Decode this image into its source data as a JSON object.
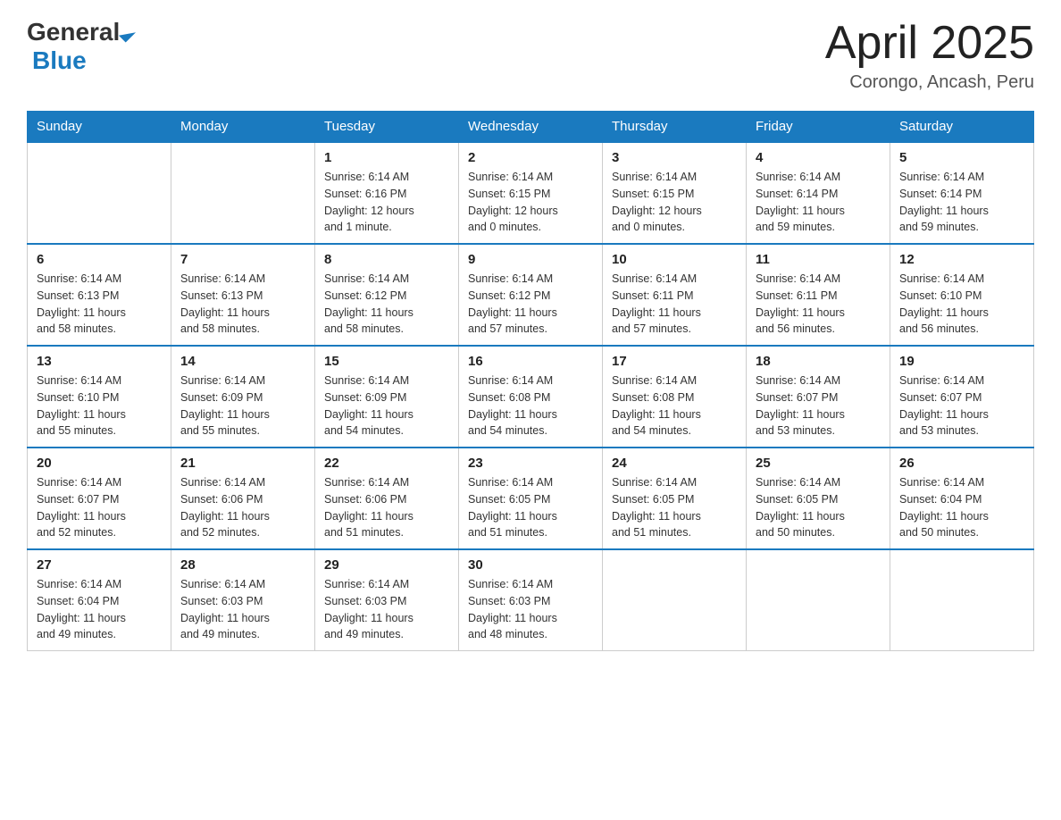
{
  "header": {
    "logo": {
      "general": "General",
      "triangle": "▶",
      "blue": "Blue"
    },
    "title": "April 2025",
    "location": "Corongo, Ancash, Peru"
  },
  "weekdays": [
    "Sunday",
    "Monday",
    "Tuesday",
    "Wednesday",
    "Thursday",
    "Friday",
    "Saturday"
  ],
  "weeks": [
    [
      {
        "day": "",
        "info": ""
      },
      {
        "day": "",
        "info": ""
      },
      {
        "day": "1",
        "info": "Sunrise: 6:14 AM\nSunset: 6:16 PM\nDaylight: 12 hours\nand 1 minute."
      },
      {
        "day": "2",
        "info": "Sunrise: 6:14 AM\nSunset: 6:15 PM\nDaylight: 12 hours\nand 0 minutes."
      },
      {
        "day": "3",
        "info": "Sunrise: 6:14 AM\nSunset: 6:15 PM\nDaylight: 12 hours\nand 0 minutes."
      },
      {
        "day": "4",
        "info": "Sunrise: 6:14 AM\nSunset: 6:14 PM\nDaylight: 11 hours\nand 59 minutes."
      },
      {
        "day": "5",
        "info": "Sunrise: 6:14 AM\nSunset: 6:14 PM\nDaylight: 11 hours\nand 59 minutes."
      }
    ],
    [
      {
        "day": "6",
        "info": "Sunrise: 6:14 AM\nSunset: 6:13 PM\nDaylight: 11 hours\nand 58 minutes."
      },
      {
        "day": "7",
        "info": "Sunrise: 6:14 AM\nSunset: 6:13 PM\nDaylight: 11 hours\nand 58 minutes."
      },
      {
        "day": "8",
        "info": "Sunrise: 6:14 AM\nSunset: 6:12 PM\nDaylight: 11 hours\nand 58 minutes."
      },
      {
        "day": "9",
        "info": "Sunrise: 6:14 AM\nSunset: 6:12 PM\nDaylight: 11 hours\nand 57 minutes."
      },
      {
        "day": "10",
        "info": "Sunrise: 6:14 AM\nSunset: 6:11 PM\nDaylight: 11 hours\nand 57 minutes."
      },
      {
        "day": "11",
        "info": "Sunrise: 6:14 AM\nSunset: 6:11 PM\nDaylight: 11 hours\nand 56 minutes."
      },
      {
        "day": "12",
        "info": "Sunrise: 6:14 AM\nSunset: 6:10 PM\nDaylight: 11 hours\nand 56 minutes."
      }
    ],
    [
      {
        "day": "13",
        "info": "Sunrise: 6:14 AM\nSunset: 6:10 PM\nDaylight: 11 hours\nand 55 minutes."
      },
      {
        "day": "14",
        "info": "Sunrise: 6:14 AM\nSunset: 6:09 PM\nDaylight: 11 hours\nand 55 minutes."
      },
      {
        "day": "15",
        "info": "Sunrise: 6:14 AM\nSunset: 6:09 PM\nDaylight: 11 hours\nand 54 minutes."
      },
      {
        "day": "16",
        "info": "Sunrise: 6:14 AM\nSunset: 6:08 PM\nDaylight: 11 hours\nand 54 minutes."
      },
      {
        "day": "17",
        "info": "Sunrise: 6:14 AM\nSunset: 6:08 PM\nDaylight: 11 hours\nand 54 minutes."
      },
      {
        "day": "18",
        "info": "Sunrise: 6:14 AM\nSunset: 6:07 PM\nDaylight: 11 hours\nand 53 minutes."
      },
      {
        "day": "19",
        "info": "Sunrise: 6:14 AM\nSunset: 6:07 PM\nDaylight: 11 hours\nand 53 minutes."
      }
    ],
    [
      {
        "day": "20",
        "info": "Sunrise: 6:14 AM\nSunset: 6:07 PM\nDaylight: 11 hours\nand 52 minutes."
      },
      {
        "day": "21",
        "info": "Sunrise: 6:14 AM\nSunset: 6:06 PM\nDaylight: 11 hours\nand 52 minutes."
      },
      {
        "day": "22",
        "info": "Sunrise: 6:14 AM\nSunset: 6:06 PM\nDaylight: 11 hours\nand 51 minutes."
      },
      {
        "day": "23",
        "info": "Sunrise: 6:14 AM\nSunset: 6:05 PM\nDaylight: 11 hours\nand 51 minutes."
      },
      {
        "day": "24",
        "info": "Sunrise: 6:14 AM\nSunset: 6:05 PM\nDaylight: 11 hours\nand 51 minutes."
      },
      {
        "day": "25",
        "info": "Sunrise: 6:14 AM\nSunset: 6:05 PM\nDaylight: 11 hours\nand 50 minutes."
      },
      {
        "day": "26",
        "info": "Sunrise: 6:14 AM\nSunset: 6:04 PM\nDaylight: 11 hours\nand 50 minutes."
      }
    ],
    [
      {
        "day": "27",
        "info": "Sunrise: 6:14 AM\nSunset: 6:04 PM\nDaylight: 11 hours\nand 49 minutes."
      },
      {
        "day": "28",
        "info": "Sunrise: 6:14 AM\nSunset: 6:03 PM\nDaylight: 11 hours\nand 49 minutes."
      },
      {
        "day": "29",
        "info": "Sunrise: 6:14 AM\nSunset: 6:03 PM\nDaylight: 11 hours\nand 49 minutes."
      },
      {
        "day": "30",
        "info": "Sunrise: 6:14 AM\nSunset: 6:03 PM\nDaylight: 11 hours\nand 48 minutes."
      },
      {
        "day": "",
        "info": ""
      },
      {
        "day": "",
        "info": ""
      },
      {
        "day": "",
        "info": ""
      }
    ]
  ]
}
